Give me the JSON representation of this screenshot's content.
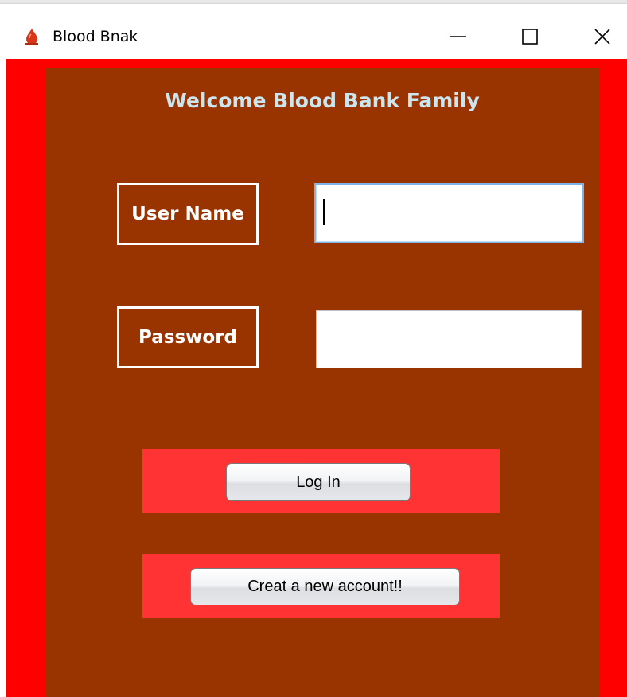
{
  "window": {
    "title": "Blood Bnak",
    "app_icon": "blood-drop-icon",
    "controls": {
      "minimize_icon": "minimize-icon",
      "maximize_icon": "maximize-icon",
      "close_icon": "close-icon"
    }
  },
  "form": {
    "heading": "Welcome Blood Bank Family",
    "username_label": "User Name",
    "username_value": "",
    "password_label": "Password",
    "password_value": "",
    "login_button": "Log In",
    "create_account_button": "Creat a new account!!"
  },
  "colors": {
    "frame_background": "#ff0000",
    "panel_background": "#993300",
    "button_band": "#ff3333",
    "heading_text": "#cce6f0",
    "label_text": "#ffffff"
  }
}
